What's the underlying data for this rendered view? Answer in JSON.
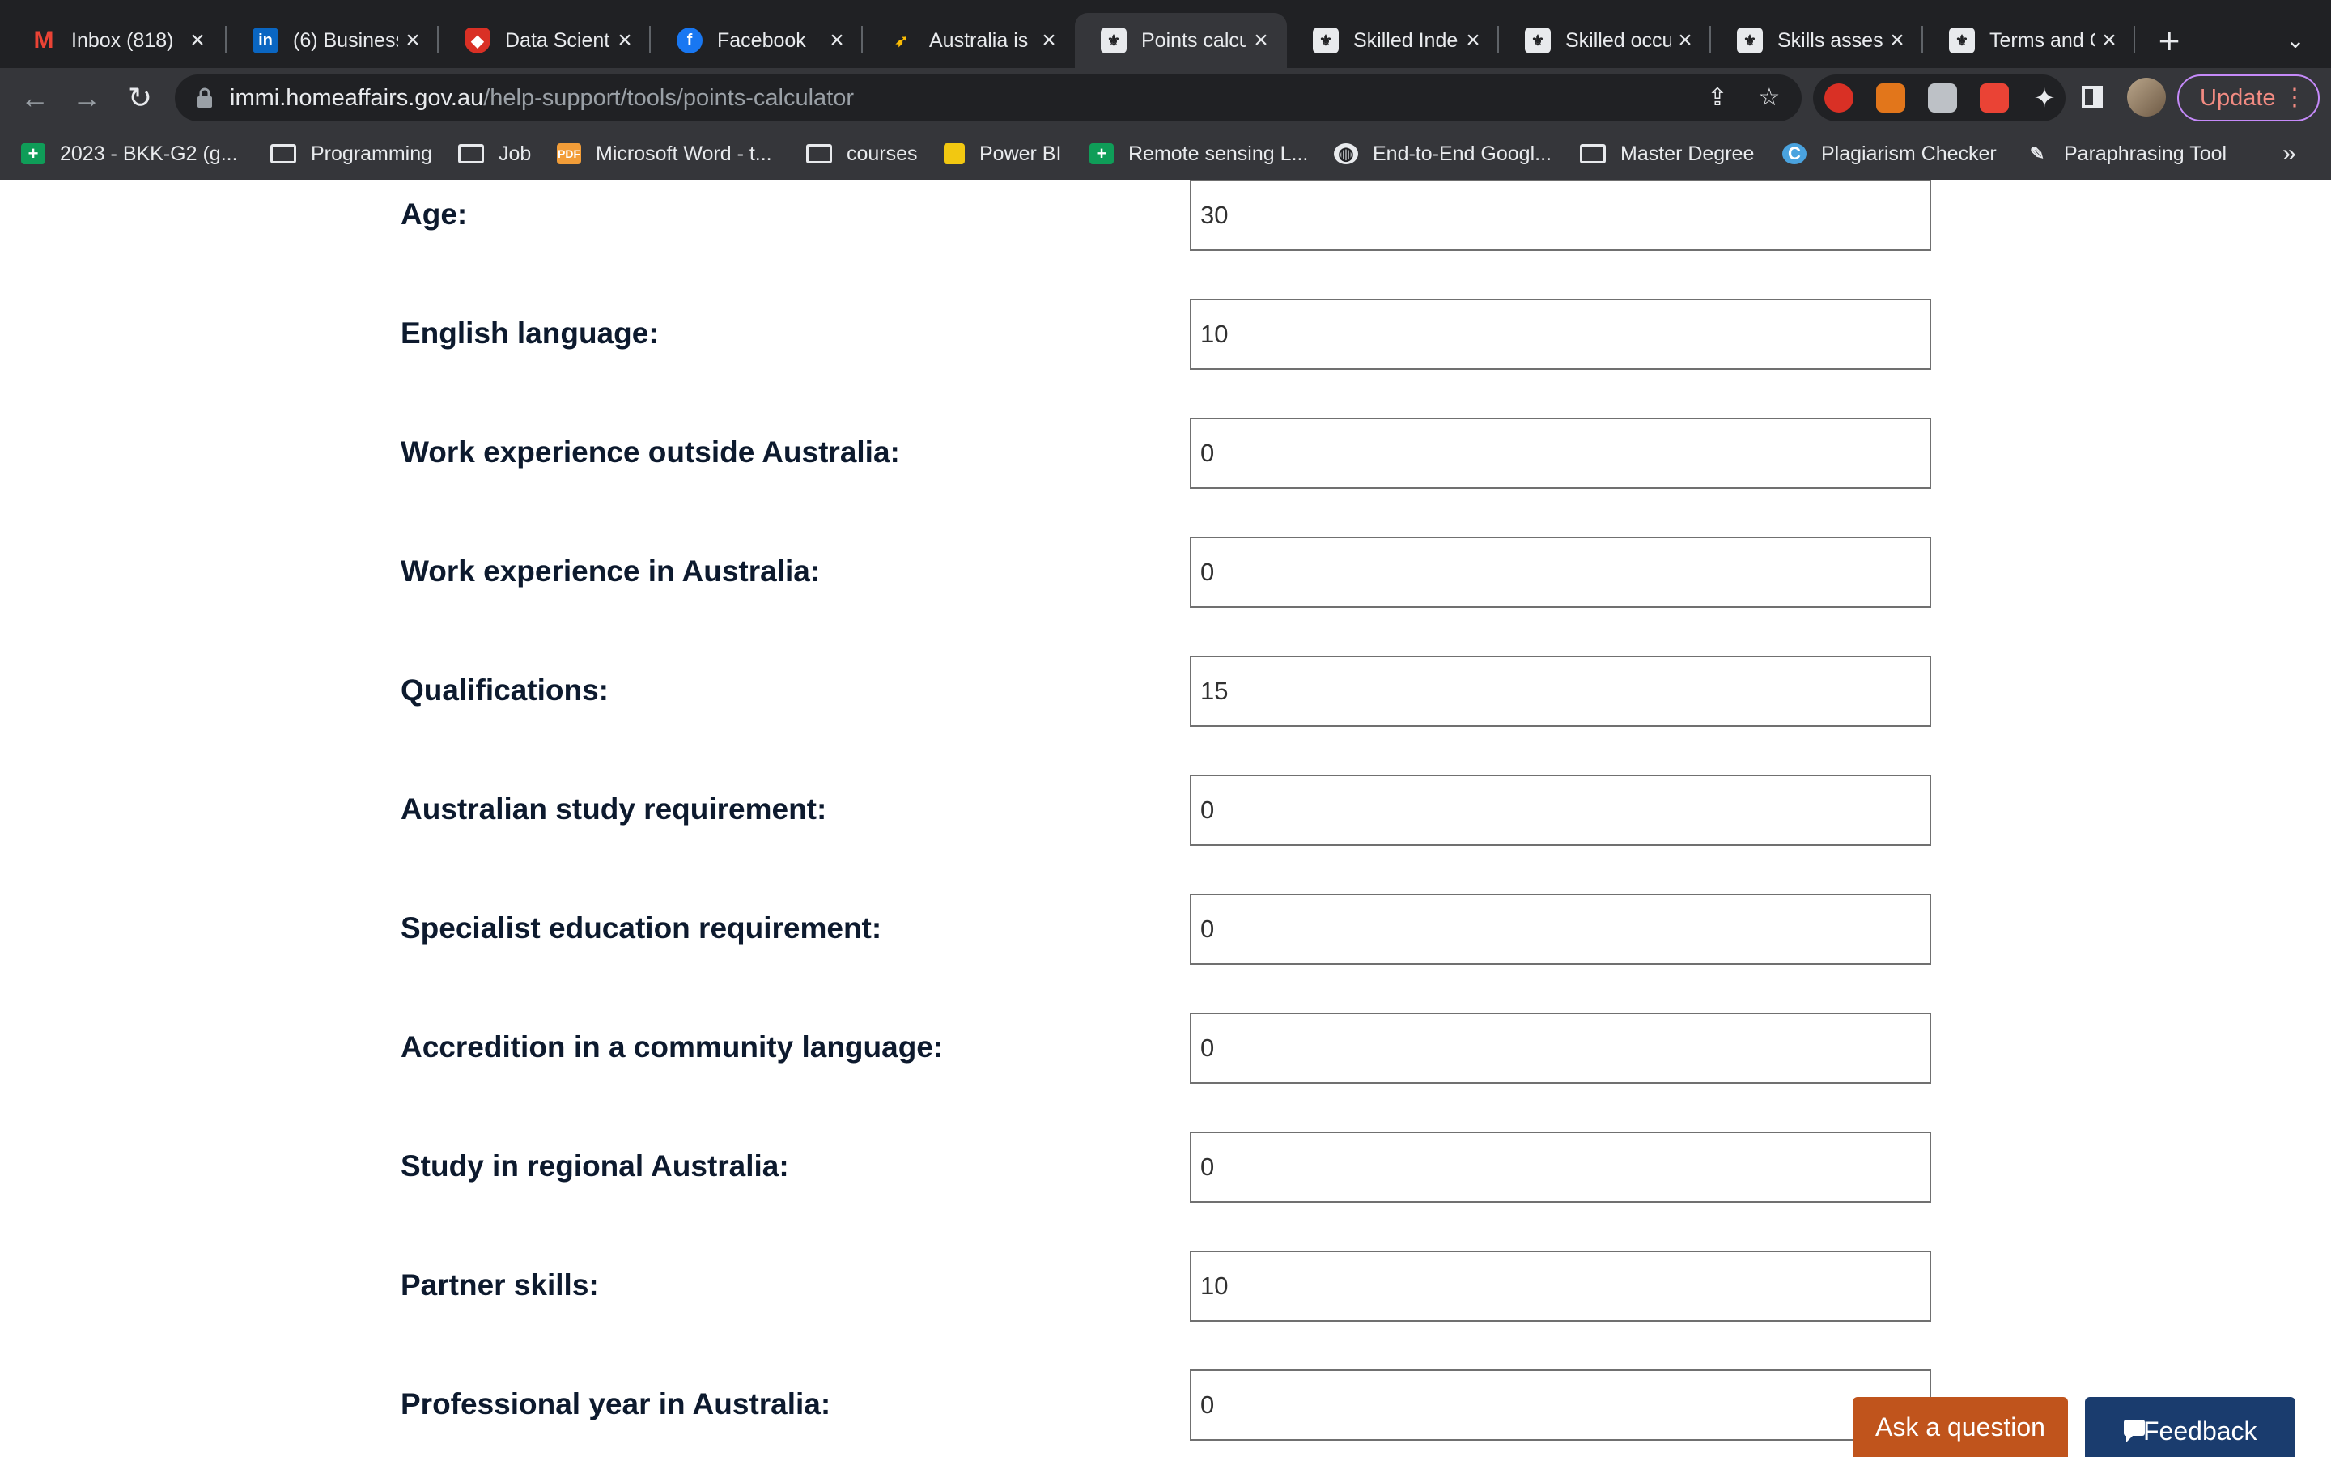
{
  "browser": {
    "tabs": [
      {
        "title": "Inbox (818)",
        "icon": "gmail-icon"
      },
      {
        "title": "(6) Business",
        "icon": "linkedin-icon"
      },
      {
        "title": "Data Scient",
        "icon": "shield-icon"
      },
      {
        "title": "Facebook",
        "icon": "facebook-icon"
      },
      {
        "title": "Australia is",
        "icon": "bird-icon"
      },
      {
        "title": "Points calcu",
        "icon": "coat-of-arms-icon",
        "active": true
      },
      {
        "title": "Skilled Inde",
        "icon": "coat-of-arms-icon"
      },
      {
        "title": "Skilled occu",
        "icon": "coat-of-arms-icon"
      },
      {
        "title": "Skills asses",
        "icon": "coat-of-arms-icon"
      },
      {
        "title": "Terms and C",
        "icon": "coat-of-arms-icon"
      }
    ],
    "address": {
      "host": "immi.homeaffairs.gov.au",
      "path": "/help-support/tools/points-calculator"
    },
    "update_label": "Update",
    "bookmarks": [
      {
        "label": "2023 - BKK-G2 (g...",
        "icon": "sheets-icon"
      },
      {
        "label": "Programming",
        "icon": "folder-icon"
      },
      {
        "label": "Job",
        "icon": "folder-icon"
      },
      {
        "label": "Microsoft Word - t...",
        "icon": "doc-icon"
      },
      {
        "label": "courses",
        "icon": "folder-icon"
      },
      {
        "label": "Power BI",
        "icon": "powerbi-icon"
      },
      {
        "label": "Remote sensing L...",
        "icon": "sheets-icon"
      },
      {
        "label": "End-to-End Googl...",
        "icon": "globe-icon"
      },
      {
        "label": "Master Degree",
        "icon": "folder-icon"
      },
      {
        "label": "Plagiarism Checker",
        "icon": "checker-icon"
      },
      {
        "label": "Paraphrasing Tool",
        "icon": "pen-icon"
      }
    ]
  },
  "form": {
    "fields": [
      {
        "label": "Age:",
        "value": "30"
      },
      {
        "label": "English language:",
        "value": "10"
      },
      {
        "label": "Work experience outside Australia:",
        "value": "0"
      },
      {
        "label": "Work experience in Australia:",
        "value": "0"
      },
      {
        "label": "Qualifications:",
        "value": "15"
      },
      {
        "label": "Australian study requirement:",
        "value": "0"
      },
      {
        "label": "Specialist education requirement:",
        "value": "0"
      },
      {
        "label": "Accredition in a community language:",
        "value": "0"
      },
      {
        "label": "Study in regional Australia:",
        "value": "0"
      },
      {
        "label": "Partner skills:",
        "value": "10"
      },
      {
        "label": "Professional year in Australia:",
        "value": "0"
      }
    ]
  },
  "widgets": {
    "ask_label": "Ask a question",
    "feedback_label": "Feedback"
  }
}
